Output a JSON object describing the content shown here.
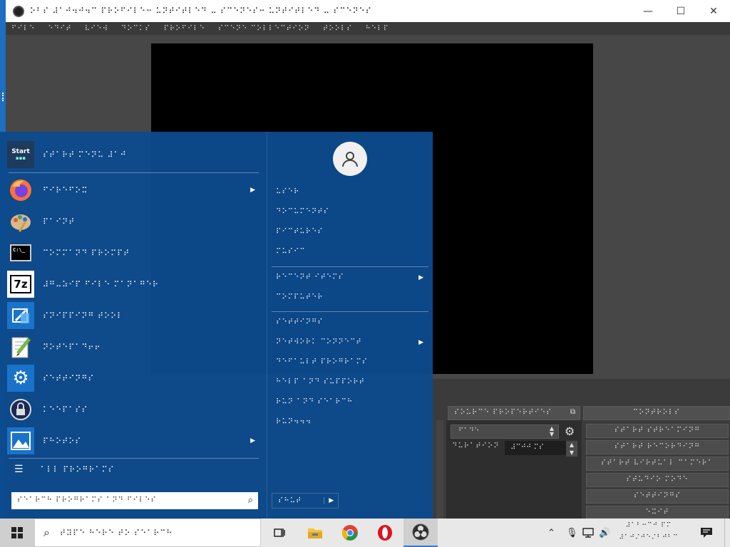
{
  "obs": {
    "title": "⠕⠃⠎ ⠼⠁⠚⠲⠚⠲⠉ ⠏⠗⠕⠋⠊⠇⠑⠒ ⠥⠝⠞⠊⠞⠇⠑⠙ ⠤ ⠎⠉⠑⠝⠑⠎⠒ ⠥⠝⠞⠊⠞⠇⠑⠙ ⠤ ⠎⠉⠑⠝⠑⠎",
    "menu": [
      "⠋⠊⠇⠑",
      "⠑⠙⠊⠞",
      "⠧⠊⠑⠺",
      "⠙⠕⠉⠅⠎",
      "⠏⠗⠕⠋⠊⠇⠑",
      "⠎⠉⠑⠝⠑ ⠉⠕⠇⠇⠑⠉⠞⠊⠕⠝",
      "⠞⠕⠕⠇⠎",
      "⠓⠑⠇⠏"
    ],
    "dock_sources_title": "⠎⠕⠥⠗⠉⠑ ⠏⠗⠕⠏⠑⠗⠞⠊⠑⠎",
    "dock_controls_title": "⠉⠕⠝⠞⠗⠕⠇⠎",
    "source_value": "⠋⠁⠙⠑",
    "duration_label": "⠙⠥⠗⠁⠞⠊⠕⠝",
    "duration_value": "⠼⠉⠚⠚ ⠍⠎",
    "controls": [
      "⠎⠞⠁⠗⠞ ⠎⠞⠗⠑⠁⠍⠊⠝⠛",
      "⠎⠞⠁⠗⠞ ⠗⠑⠉⠕⠗⠙⠊⠝⠛",
      "⠎⠞⠁⠗⠞ ⠧⠊⠗⠞⠥⠁⠇ ⠉⠁⠍⠑⠗⠁",
      "⠎⠞⠥⠙⠊⠕ ⠍⠕⠙⠑",
      "⠎⠑⠞⠞⠊⠝⠛⠎",
      "⠑⠭⠊⠞"
    ]
  },
  "start_menu": {
    "pinned": [
      {
        "label": "⠎⠞⠁⠗⠞ ⠍⠑⠝⠥ ⠼⠁⠚",
        "icon": "start-icon",
        "arrow": false
      },
      {
        "label": "⠋⠊⠗⠑⠋⠕⠭",
        "icon": "firefox-icon",
        "arrow": true
      },
      {
        "label": "⠏⠁⠊⠝⠞",
        "icon": "paint-icon",
        "arrow": false
      },
      {
        "label": "⠉⠕⠍⠍⠁⠝⠙ ⠏⠗⠕⠍⠏⠞",
        "icon": "command-prompt-icon",
        "arrow": false
      },
      {
        "label": "⠼⠛⠤⠵⠊⠏ ⠋⠊⠇⠑ ⠍⠁⠝⠁⠛⠑⠗",
        "icon": "7zip-icon",
        "arrow": false
      },
      {
        "label": "⠎⠝⠊⠏⠏⠊⠝⠛ ⠞⠕⠕⠇",
        "icon": "snipping-tool-icon",
        "arrow": false
      },
      {
        "label": "⠝⠕⠞⠑⠏⠁⠙⠖⠖",
        "icon": "notepadpp-icon",
        "arrow": false
      },
      {
        "label": "⠎⠑⠞⠞⠊⠝⠛⠎",
        "icon": "settings-icon",
        "arrow": false
      },
      {
        "label": "⠅⠑⠑⠏⠁⠎⠎",
        "icon": "keepass-icon",
        "arrow": false
      },
      {
        "label": "⠏⠓⠕⠞⠕⠎",
        "icon": "photos-icon",
        "arrow": true
      }
    ],
    "all_programs": "⠁⠇⠇ ⠏⠗⠕⠛⠗⠁⠍⠎",
    "search_placeholder": "⠎⠑⠁⠗⠉⠓ ⠏⠗⠕⠛⠗⠁⠍⠎ ⠁⠝⠙ ⠋⠊⠇⠑⠎",
    "right": [
      {
        "label": "⠥⠎⠑⠗",
        "arrow": false
      },
      {
        "label": "⠙⠕⠉⠥⠍⠑⠝⠞⠎",
        "arrow": false
      },
      {
        "label": "⠏⠊⠉⠞⠥⠗⠑⠎",
        "arrow": false
      },
      {
        "label": "⠍⠥⠎⠊⠉",
        "arrow": false
      },
      {
        "label": "⠗⠑⠉⠑⠝⠞ ⠊⠞⠑⠍⠎",
        "arrow": true
      },
      {
        "label": "⠉⠕⠍⠏⠥⠞⠑⠗",
        "arrow": false
      },
      {
        "label": "⠎⠑⠞⠞⠊⠝⠛⠎",
        "arrow": false
      },
      {
        "label": "⠝⠑⠞⠺⠕⠗⠅ ⠉⠕⠝⠝⠑⠉⠞",
        "arrow": true
      },
      {
        "label": "⠙⠑⠋⠁⠥⠇⠞ ⠏⠗⠕⠛⠗⠁⠍⠎",
        "arrow": false
      },
      {
        "label": "⠓⠑⠇⠏ ⠁⠝⠙ ⠎⠥⠏⠏⠕⠗⠞",
        "arrow": false
      },
      {
        "label": "⠗⠥⠝ ⠁⠝⠙ ⠎⠑⠁⠗⠉⠓",
        "arrow": false
      },
      {
        "label": "⠗⠥⠝⠲⠲⠲",
        "arrow": false
      }
    ],
    "shutdown_label": "⠎⠓⠥⠞"
  },
  "taskbar": {
    "search_text": "⠞⠽⠏⠑ ⠓⠑⠗⠑ ⠞⠕ ⠎⠑⠁⠗⠉⠓",
    "apps": [
      "task-view-icon",
      "file-explorer-icon",
      "chrome-icon",
      "opera-icon",
      "obs-icon"
    ],
    "clock_time": "⠼⠁⠃⠒⠉⠚ ⠏⠍",
    "clock_date": "⠼⠁⠚⠌⠚⠑⠌⠃⠚⠃⠉"
  }
}
